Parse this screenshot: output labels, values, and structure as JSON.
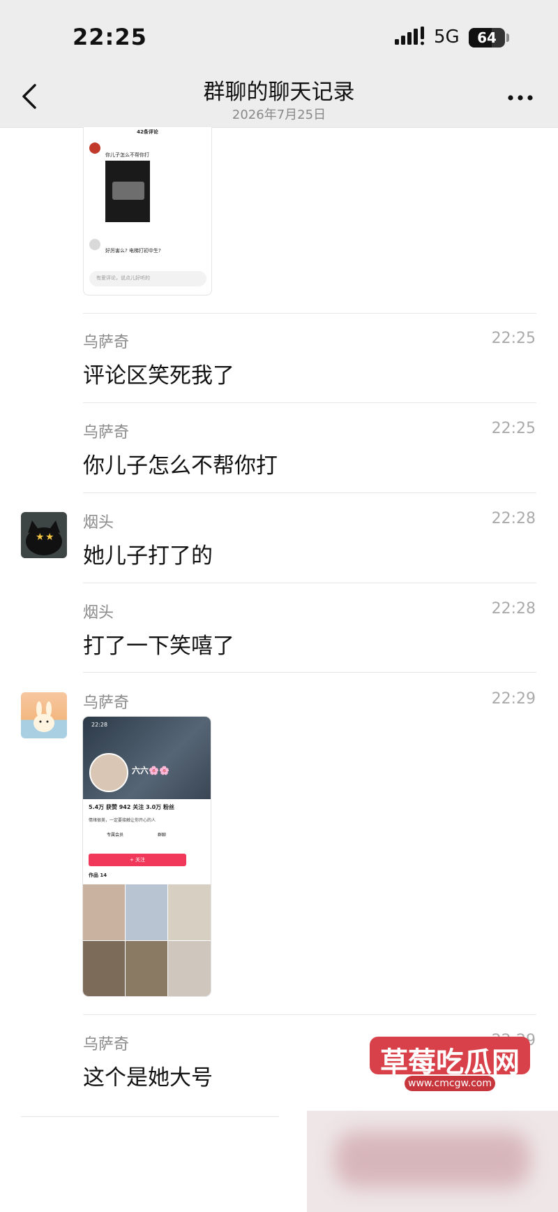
{
  "status_bar": {
    "time": "22:25",
    "network": "5G",
    "battery": "64",
    "battery_level": 0.64
  },
  "header": {
    "title": "群聊的聊天记录",
    "date": "2026年7月25日"
  },
  "top_image": {
    "count_title": "42条评论",
    "comment1": "你儿子怎么不帮你打",
    "comment2": "好厉害么? 电梯打初中生?",
    "input_placeholder": "有爱评论，说点儿好听的"
  },
  "messages": [
    {
      "name": "乌萨奇",
      "time": "22:25",
      "text": "评论区笑死我了"
    },
    {
      "name": "乌萨奇",
      "time": "22:25",
      "text": "你儿子怎么不帮你打"
    },
    {
      "name": "烟头",
      "time": "22:28",
      "text": "她儿子打了的"
    },
    {
      "name": "烟头",
      "time": "22:28",
      "text": "打了一下笑嘻了"
    },
    {
      "name": "乌萨奇",
      "time": "22:29",
      "text": ""
    },
    {
      "name": "乌萨奇",
      "time": "22:29",
      "text": "这个是她大号"
    }
  ],
  "profile_card": {
    "time": "22:28",
    "name": "六六🌸🌸",
    "stats": "5.4万 获赞  942 关注  3.0万 粉丝",
    "bio": "情绪很美，一定要接触让你开心的人",
    "tag1": "专属会员",
    "tag2": "群聊",
    "follow_button": "+ 关注",
    "works": "作品 14"
  },
  "watermark": {
    "text": "草莓吃瓜网",
    "url": "www.cmcgw.com"
  }
}
